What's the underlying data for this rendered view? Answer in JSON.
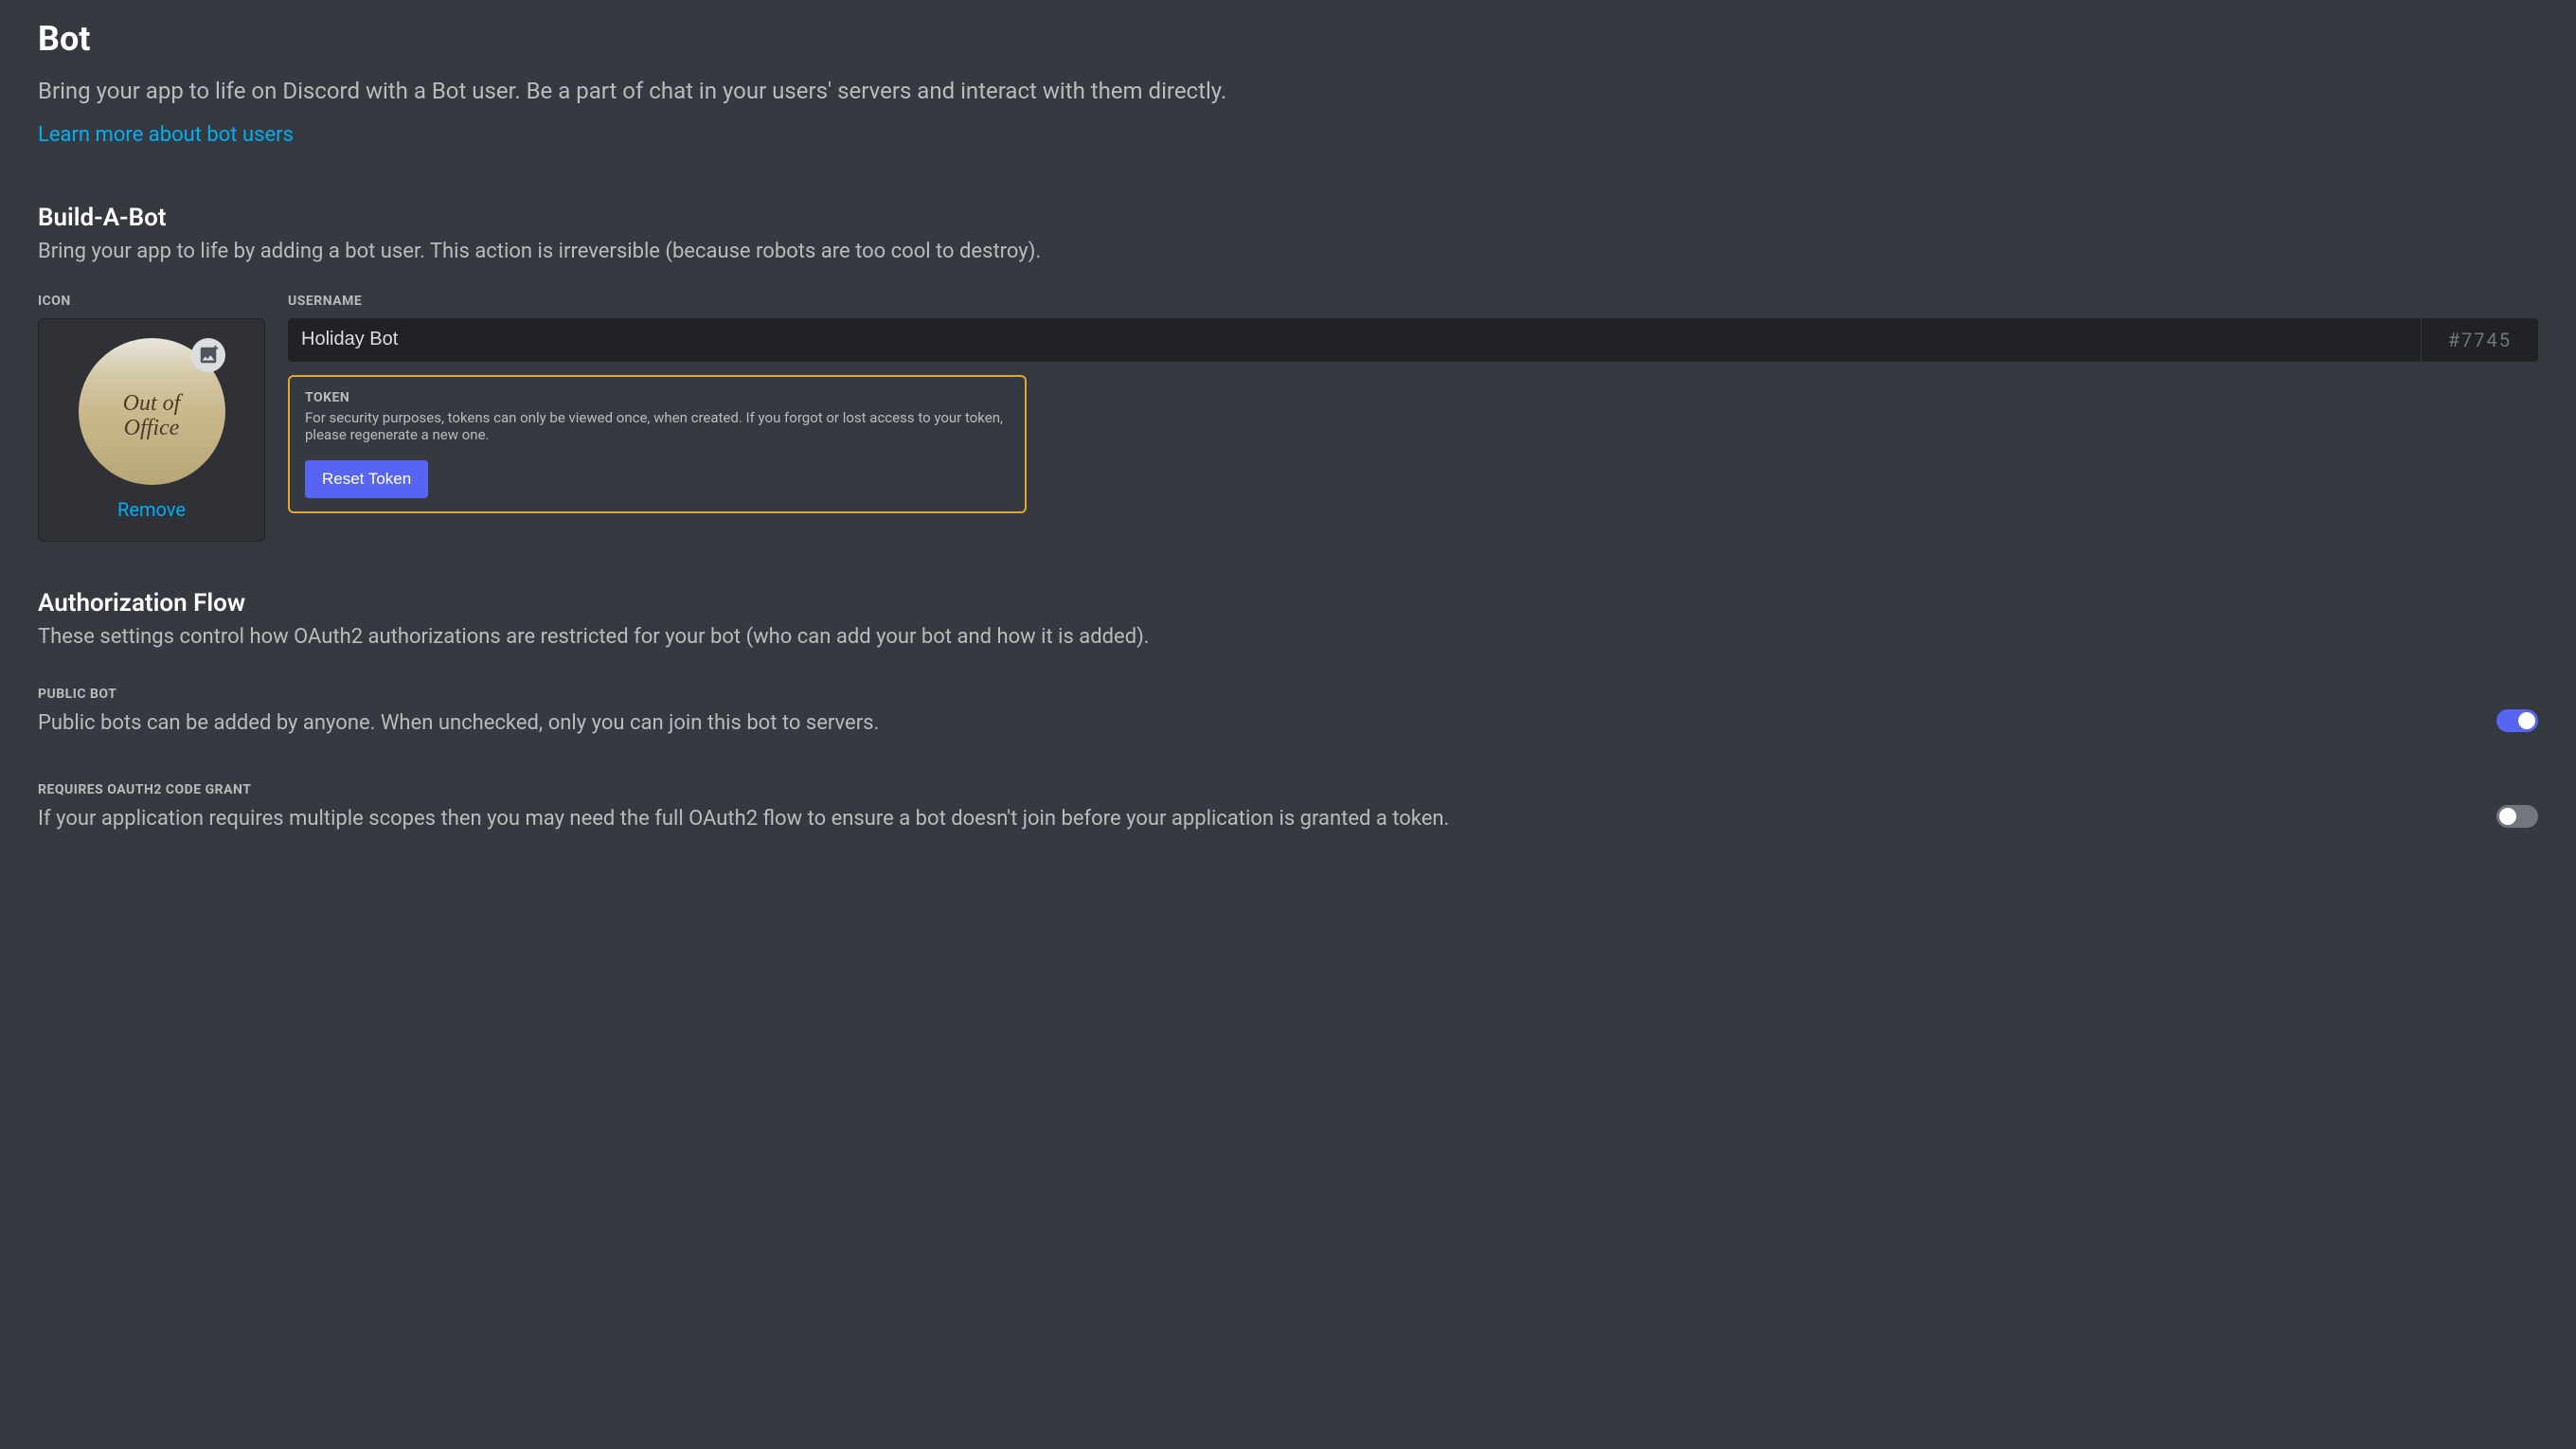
{
  "header": {
    "title": "Bot",
    "description": "Bring your app to life on Discord with a Bot user. Be a part of chat in your users' servers and interact with them directly.",
    "learn_more": "Learn more about bot users"
  },
  "build": {
    "title": "Build-A-Bot",
    "description": "Bring your app to life by adding a bot user. This action is irreversible (because robots are too cool to destroy).",
    "icon_label": "ICON",
    "avatar_text": "Out of Office",
    "remove_label": "Remove",
    "username_label": "USERNAME",
    "username_value": "Holiday Bot",
    "username_tag": "#7745",
    "token_label": "TOKEN",
    "token_description": "For security purposes, tokens can only be viewed once, when created. If you forgot or lost access to your token, please regenerate a new one.",
    "reset_token_label": "Reset Token"
  },
  "auth": {
    "title": "Authorization Flow",
    "description": "These settings control how OAuth2 authorizations are restricted for your bot (who can add your bot and how it is added).",
    "public_bot": {
      "label": "PUBLIC BOT",
      "description": "Public bots can be added by anyone. When unchecked, only you can join this bot to servers.",
      "enabled": true
    },
    "oauth_grant": {
      "label": "REQUIRES OAUTH2 CODE GRANT",
      "description": "If your application requires multiple scopes then you may need the full OAuth2 flow to ensure a bot doesn't join before your application is granted a token.",
      "enabled": false
    }
  }
}
